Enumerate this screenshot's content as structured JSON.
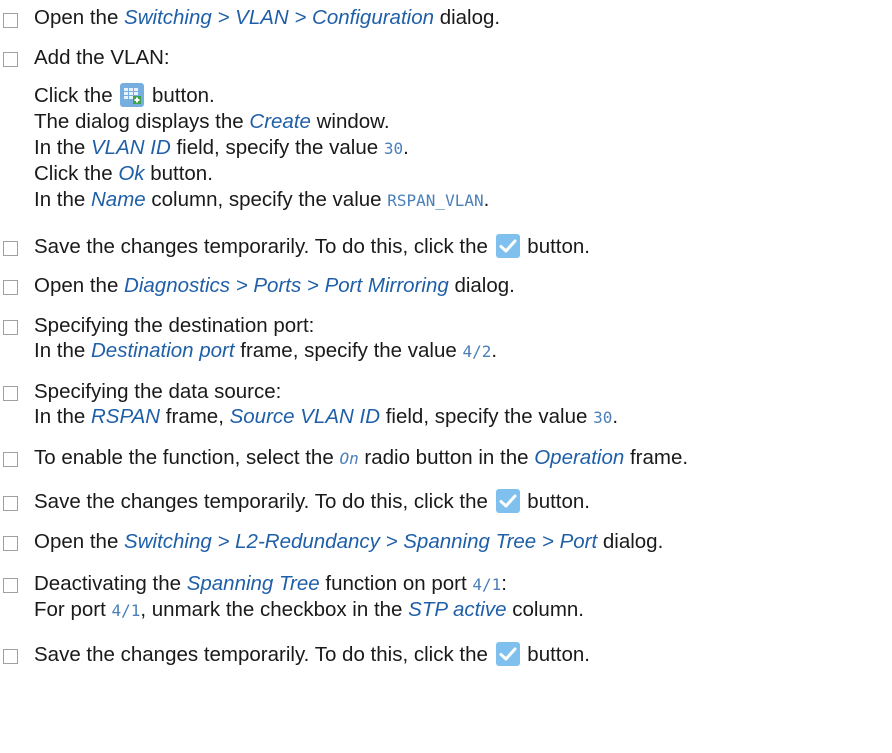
{
  "steps": [
    {
      "parts": [
        {
          "t": "Open the "
        },
        {
          "r": "Switching > VLAN > Configuration"
        },
        {
          "t": " dialog."
        }
      ]
    },
    {
      "first": "Add the VLAN:",
      "sub": [
        {
          "a": "Click the ",
          "icon": "add-row-icon",
          "b": " button."
        },
        {
          "t": "The dialog displays the ",
          "r": "Create",
          "u": " window."
        },
        {
          "t": "In the ",
          "r": "VLAN ID",
          "u": " field, specify the value ",
          "c": "30",
          "v": "."
        },
        {
          "t": "Click the ",
          "r": "Ok",
          "u": " button."
        },
        {
          "t": "In the ",
          "r": "Name",
          "u": " column, specify the value ",
          "c": "RSPAN_VLAN",
          "v": "."
        }
      ]
    },
    {
      "text": "Save the changes temporarily. To do this, click the ",
      "icon": "checkmark-icon",
      "tail": " button."
    },
    {
      "t": "Open the ",
      "r": "Diagnostics > Ports > Port Mirroring",
      "u": " dialog."
    },
    {
      "first": "Specifying the destination port:",
      "second": {
        "t": "In the ",
        "r": "Destination port",
        "u": " frame, specify the value ",
        "c": "4/2",
        "v": "."
      }
    },
    {
      "first": "Specifying the data source:",
      "second": {
        "t": "In the ",
        "r": "RSPAN",
        "u": " frame, ",
        "r2": "Source VLAN ID",
        "u2": " field, specify the value ",
        "c": "30",
        "v": "."
      }
    },
    {
      "t": "To enable the function, select the ",
      "ci": "On",
      "u": " radio button in the ",
      "r": "Operation",
      "v": " frame."
    },
    {
      "text": "Save the changes temporarily. To do this, click the ",
      "icon": "checkmark-icon",
      "tail": " button."
    },
    {
      "t": "Open the ",
      "r": "Switching > L2-Redundancy > Spanning Tree > Port",
      "u": " dialog."
    },
    {
      "first": {
        "t": "Deactivating the ",
        "r": "Spanning Tree",
        "u": " function on port ",
        "c": "4/1",
        "v": ":"
      },
      "second": {
        "t": "For port ",
        "c": "4/1",
        "u": ", unmark the checkbox in the ",
        "r": "STP active",
        "v": " column."
      }
    },
    {
      "text": "Save the changes temporarily. To do this, click the ",
      "icon": "checkmark-icon",
      "tail": " button."
    }
  ]
}
